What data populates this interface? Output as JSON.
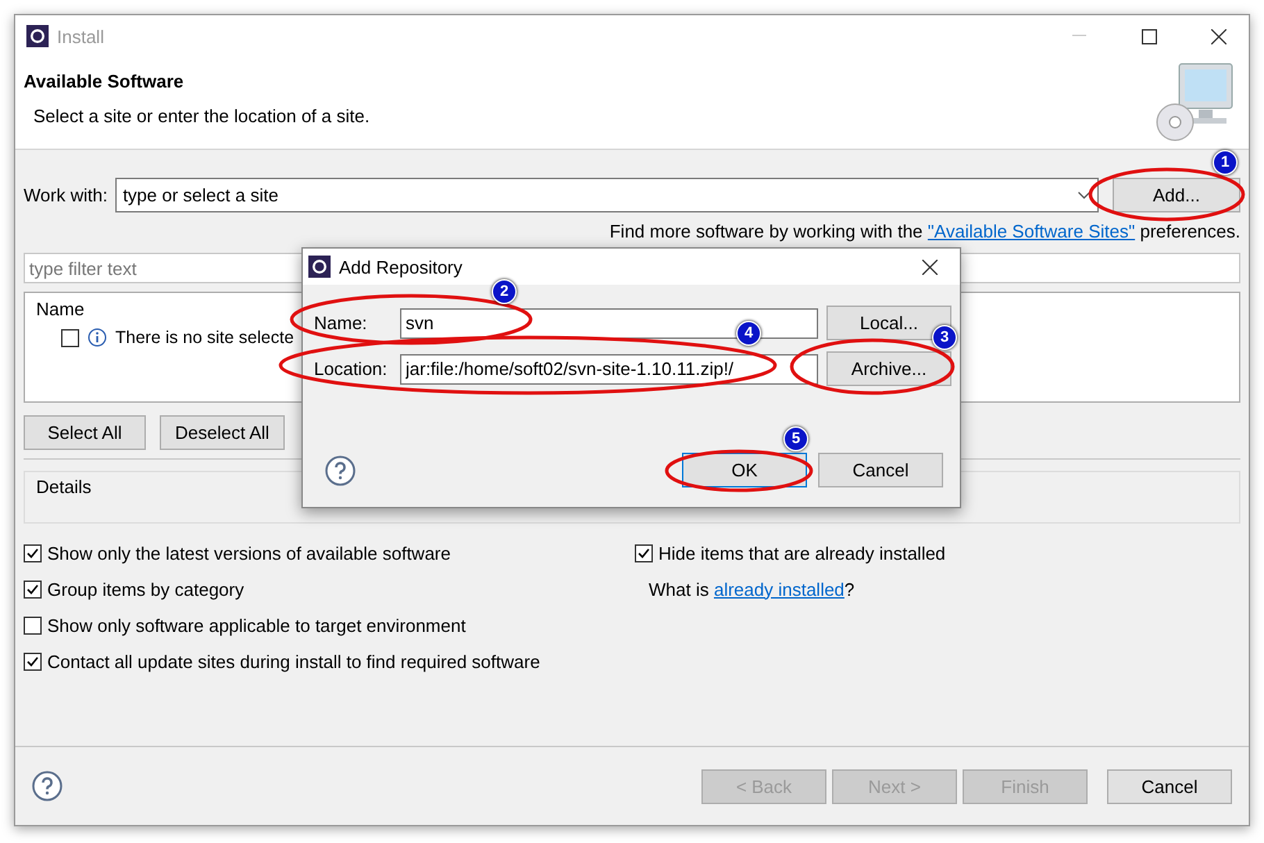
{
  "window": {
    "title": "Install"
  },
  "header": {
    "title": "Available Software",
    "subtitle": "Select a site or enter the location of a site."
  },
  "work_with": {
    "label": "Work with:",
    "placeholder": "type or select a site",
    "add_button": "Add..."
  },
  "more_software": {
    "text": "Find more software by working with the",
    "link": "\"Available Software Sites\"",
    "suffix": "preferences."
  },
  "filter": {
    "placeholder": "type filter text"
  },
  "tree": {
    "column": "Name",
    "rows": [
      {
        "text": "There is no site selecte",
        "checked": false
      }
    ]
  },
  "selection_buttons": [
    "Select All",
    "Deselect All"
  ],
  "details": {
    "label": "Details"
  },
  "options_left": [
    {
      "label": "Show only the latest versions of available software",
      "checked": true
    },
    {
      "label": "Group items by category",
      "checked": true
    },
    {
      "label": "Show only software applicable to target environment",
      "checked": false
    },
    {
      "label": "Contact all update sites during install to find required software",
      "checked": true
    }
  ],
  "options_right": [
    {
      "label": "Hide items that are already installed",
      "checked": true
    }
  ],
  "installed_hint": {
    "text": "What is",
    "link": "already installed",
    "suffix": "?"
  },
  "footer_buttons": [
    {
      "label": "< Back",
      "disabled": true
    },
    {
      "label": "Next >",
      "disabled": true
    },
    {
      "label": "Finish",
      "disabled": true
    },
    {
      "label": "Cancel",
      "disabled": false
    }
  ],
  "dialog": {
    "title": "Add Repository",
    "name_label": "Name:",
    "name_value": "svn",
    "location_label": "Location:",
    "location_value": "jar:file:/home/soft02/svn-site-1.10.11.zip!/",
    "local_button": "Local...",
    "archive_button": "Archive...",
    "ok_button": "OK",
    "cancel_button": "Cancel"
  },
  "annotations": [
    {
      "number": "1"
    },
    {
      "number": "2"
    },
    {
      "number": "3"
    },
    {
      "number": "4"
    },
    {
      "number": "5"
    }
  ]
}
